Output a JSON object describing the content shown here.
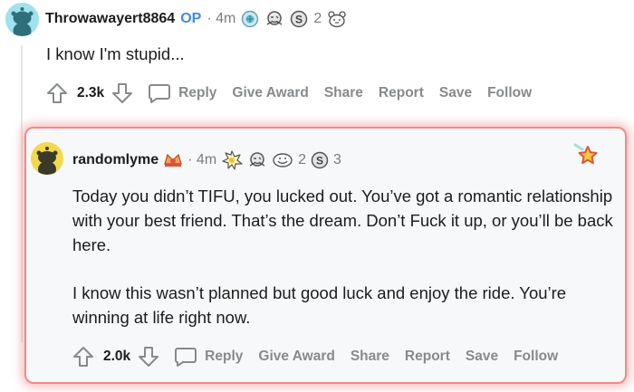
{
  "comment_op": {
    "username": "Throwawayert8864",
    "op_badge": "OP",
    "time": "· 4m",
    "awards": [
      {
        "icon": "globe-award-icon"
      },
      {
        "icon": "wink-award-icon"
      },
      {
        "icon": "silver-award-icon",
        "count": "2"
      },
      {
        "icon": "bear-award-icon"
      }
    ],
    "body": "I know I'm stupid...",
    "score": "2.3k",
    "actions": {
      "reply": "Reply",
      "give_award": "Give Award",
      "share": "Share",
      "report": "Report",
      "save": "Save",
      "follow": "Follow"
    }
  },
  "comment_reply": {
    "username": "randomlyme",
    "time": "· 4m",
    "awards": [
      {
        "icon": "starburst-award-icon"
      },
      {
        "icon": "wink-award-icon"
      },
      {
        "icon": "smile-award-icon",
        "count": "2"
      },
      {
        "icon": "silver-award-icon",
        "count": "3"
      }
    ],
    "paragraphs": [
      "Today you didn’t TIFU, you lucked out. You’ve got a romantic relationship with your best friend. That’s the dream. Don’t Fuck it up, or you’ll be back here.",
      "I know this wasn’t planned but good luck and enjoy the ride. You’re winning at life right now."
    ],
    "score": "2.0k",
    "actions": {
      "reply": "Reply",
      "give_award": "Give Award",
      "share": "Share",
      "report": "Report",
      "save": "Save",
      "follow": "Follow"
    }
  },
  "colors": {
    "op_badge": "#3e8de5",
    "highlight_border": "#f08a8a",
    "meta_gray": "#878a8c"
  }
}
